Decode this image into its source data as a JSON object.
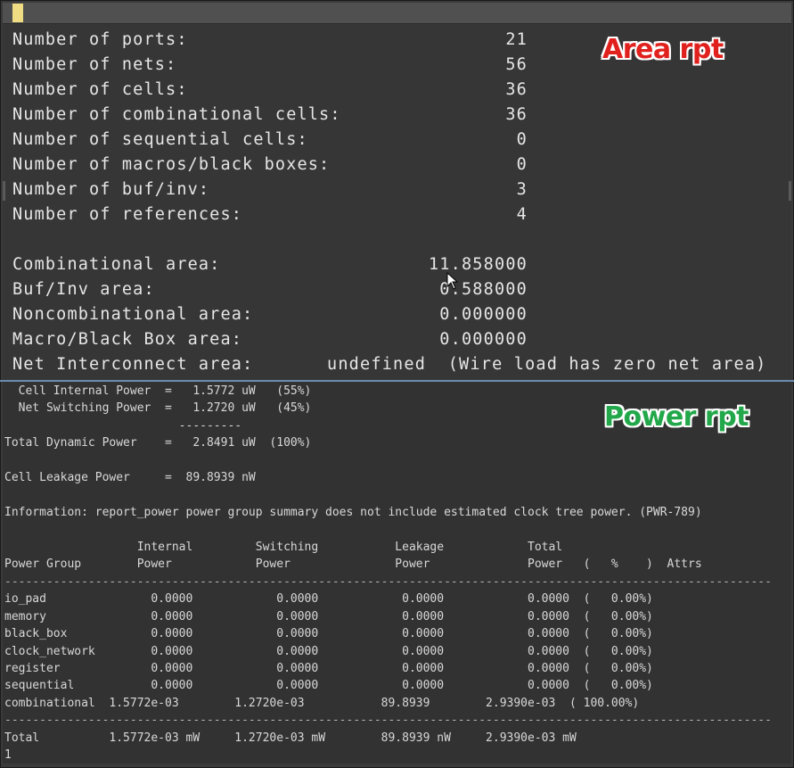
{
  "area_title": "Area rpt",
  "power_title": "Power rpt",
  "area_report": [
    {
      "label": "Number of ports:",
      "value": "21"
    },
    {
      "label": "Number of nets:",
      "value": "56"
    },
    {
      "label": "Number of cells:",
      "value": "36"
    },
    {
      "label": "Number of combinational cells:",
      "value": "36"
    },
    {
      "label": "Number of sequential cells:",
      "value": "0"
    },
    {
      "label": "Number of macros/black boxes:",
      "value": "0"
    },
    {
      "label": "Number of buf/inv:",
      "value": "3"
    },
    {
      "label": "Number of references:",
      "value": "4"
    },
    {
      "label": "",
      "value": ""
    },
    {
      "label": "Combinational area:",
      "value": "11.858000"
    },
    {
      "label": "Buf/Inv area:",
      "value": "0.588000"
    },
    {
      "label": "Noncombinational area:",
      "value": "0.000000"
    },
    {
      "label": "Macro/Black Box area:",
      "value": "0.000000"
    },
    {
      "label": "Net Interconnect area:",
      "value": "undefined  (Wire load has zero net area)"
    }
  ],
  "power_summary": {
    "cell_internal": "  Cell Internal Power  =   1.5772 uW   (55%)",
    "net_switching": "  Net Switching Power  =   1.2720 uW   (45%)",
    "dash_line": "                         ---------",
    "total_dynamic": "Total Dynamic Power    =   2.8491 uW  (100%)",
    "blank1": "",
    "cell_leakage": "Cell Leakage Power     =  89.8939 nW",
    "blank2": "",
    "information": "Information: report_power power group summary does not include estimated clock tree power. (PWR-789)",
    "blank3": ""
  },
  "power_table": {
    "header1": "                   Internal         Switching           Leakage            Total",
    "header2": "Power Group        Power            Power               Power              Power   (   %    )  Attrs",
    "separator": "--------------------------------------------------------------------------------------------------------------",
    "rows": [
      "io_pad               0.0000            0.0000            0.0000            0.0000  (   0.00%)",
      "memory               0.0000            0.0000            0.0000            0.0000  (   0.00%)",
      "black_box            0.0000            0.0000            0.0000            0.0000  (   0.00%)",
      "clock_network        0.0000            0.0000            0.0000            0.0000  (   0.00%)",
      "register             0.0000            0.0000            0.0000            0.0000  (   0.00%)",
      "sequential           0.0000            0.0000            0.0000            0.0000  (   0.00%)",
      "combinational  1.5772e-03        1.2720e-03           89.8939        2.9390e-03  ( 100.00%)"
    ],
    "separator2": "--------------------------------------------------------------------------------------------------------------",
    "total": "Total          1.5772e-03 mW     1.2720e-03 mW        89.8939 nW     2.9390e-03 mW",
    "trailer": "1"
  },
  "colors": {
    "area_title": "#e0211d",
    "power_title": "#22a84a",
    "cursor": "#f0dc82"
  }
}
